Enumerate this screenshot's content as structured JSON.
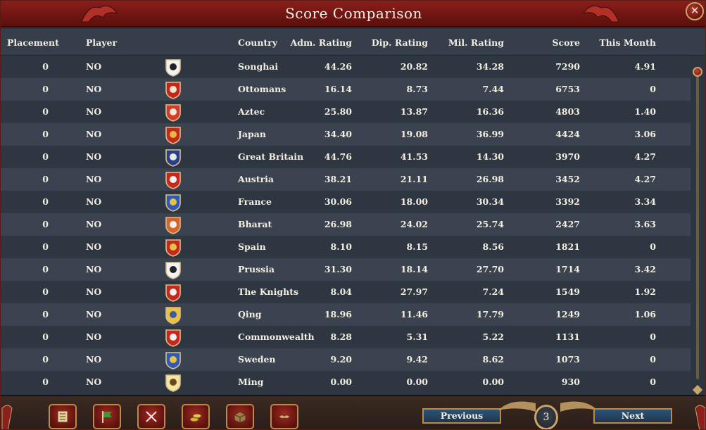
{
  "window": {
    "title": "Score Comparison"
  },
  "headers": {
    "placement": "Placement",
    "player": "Player",
    "country": "Country",
    "adm": "Adm. Rating",
    "dip": "Dip. Rating",
    "mil": "Mil. Rating",
    "score": "Score",
    "month": "This Month"
  },
  "rows": [
    {
      "placement": "0",
      "player": "NO",
      "flag": "songhai-flag-icon",
      "country": "Songhai",
      "adm": "44.26",
      "dip": "20.82",
      "mil": "34.28",
      "score": "7290",
      "month": "4.91"
    },
    {
      "placement": "0",
      "player": "NO",
      "flag": "ottomans-flag-icon",
      "country": "Ottomans",
      "adm": "16.14",
      "dip": "8.73",
      "mil": "7.44",
      "score": "6753",
      "month": "0"
    },
    {
      "placement": "0",
      "player": "NO",
      "flag": "aztec-flag-icon",
      "country": "Aztec",
      "adm": "25.80",
      "dip": "13.87",
      "mil": "16.36",
      "score": "4803",
      "month": "1.40"
    },
    {
      "placement": "0",
      "player": "NO",
      "flag": "japan-flag-icon",
      "country": "Japan",
      "adm": "34.40",
      "dip": "19.08",
      "mil": "36.99",
      "score": "4424",
      "month": "3.06"
    },
    {
      "placement": "0",
      "player": "NO",
      "flag": "great-britain-flag-icon",
      "country": "Great Britain",
      "adm": "44.76",
      "dip": "41.53",
      "mil": "14.30",
      "score": "3970",
      "month": "4.27"
    },
    {
      "placement": "0",
      "player": "NO",
      "flag": "austria-flag-icon",
      "country": "Austria",
      "adm": "38.21",
      "dip": "21.11",
      "mil": "26.98",
      "score": "3452",
      "month": "4.27"
    },
    {
      "placement": "0",
      "player": "NO",
      "flag": "france-flag-icon",
      "country": "France",
      "adm": "30.06",
      "dip": "18.00",
      "mil": "30.34",
      "score": "3392",
      "month": "3.34"
    },
    {
      "placement": "0",
      "player": "NO",
      "flag": "bharat-flag-icon",
      "country": "Bharat",
      "adm": "26.98",
      "dip": "24.02",
      "mil": "25.74",
      "score": "2427",
      "month": "3.63"
    },
    {
      "placement": "0",
      "player": "NO",
      "flag": "spain-flag-icon",
      "country": "Spain",
      "adm": "8.10",
      "dip": "8.15",
      "mil": "8.56",
      "score": "1821",
      "month": "0"
    },
    {
      "placement": "0",
      "player": "NO",
      "flag": "prussia-flag-icon",
      "country": "Prussia",
      "adm": "31.30",
      "dip": "18.14",
      "mil": "27.70",
      "score": "1714",
      "month": "3.42"
    },
    {
      "placement": "0",
      "player": "NO",
      "flag": "the-knights-flag-icon",
      "country": "The Knights",
      "adm": "8.04",
      "dip": "27.97",
      "mil": "7.24",
      "score": "1549",
      "month": "1.92"
    },
    {
      "placement": "0",
      "player": "NO",
      "flag": "qing-flag-icon",
      "country": "Qing",
      "adm": "18.96",
      "dip": "11.46",
      "mil": "17.79",
      "score": "1249",
      "month": "1.06"
    },
    {
      "placement": "0",
      "player": "NO",
      "flag": "commonwealth-flag-icon",
      "country": "Commonwealth",
      "adm": "8.28",
      "dip": "5.31",
      "mil": "5.22",
      "score": "1131",
      "month": "0"
    },
    {
      "placement": "0",
      "player": "NO",
      "flag": "sweden-flag-icon",
      "country": "Sweden",
      "adm": "9.20",
      "dip": "9.42",
      "mil": "8.62",
      "score": "1073",
      "month": "0"
    },
    {
      "placement": "0",
      "player": "NO",
      "flag": "ming-flag-icon",
      "country": "Ming",
      "adm": "0.00",
      "dip": "0.00",
      "mil": "0.00",
      "score": "930",
      "month": "0"
    }
  ],
  "flag_colors": {
    "songhai-flag-icon": [
      "#f2f2f2",
      "#222222"
    ],
    "ottomans-flag-icon": [
      "#c4261c",
      "#f2e6c8"
    ],
    "aztec-flag-icon": [
      "#d23a2a",
      "#f4e8d8"
    ],
    "japan-flag-icon": [
      "#c42a1c",
      "#e8b840"
    ],
    "great-britain-flag-icon": [
      "#2a3f8c",
      "#e8e8e8"
    ],
    "austria-flag-icon": [
      "#c8281c",
      "#f2f2f2"
    ],
    "france-flag-icon": [
      "#2f5cb2",
      "#e8c240"
    ],
    "bharat-flag-icon": [
      "#d8642a",
      "#f2f2f2"
    ],
    "spain-flag-icon": [
      "#c42a1c",
      "#e8c240"
    ],
    "prussia-flag-icon": [
      "#f2f2f2",
      "#222222"
    ],
    "the-knights-flag-icon": [
      "#c42a1c",
      "#f2f2f2"
    ],
    "qing-flag-icon": [
      "#e8c240",
      "#3a5ca8"
    ],
    "commonwealth-flag-icon": [
      "#c8281c",
      "#f2f2f2"
    ],
    "sweden-flag-icon": [
      "#2f5cb2",
      "#e8c240"
    ],
    "ming-flag-icon": [
      "#f2e6a0",
      "#6a4a20"
    ]
  },
  "toolbar": [
    {
      "icon": "ledger-icon"
    },
    {
      "icon": "flag-icon"
    },
    {
      "icon": "crossed-swords-icon"
    },
    {
      "icon": "coins-icon"
    },
    {
      "icon": "crate-icon"
    },
    {
      "icon": "handshake-icon"
    }
  ],
  "pagination": {
    "previous_label": "Previous",
    "next_label": "Next",
    "current_page": "3"
  },
  "theme": {
    "title_bar": "#8a1f1b",
    "row_even": "#2e3641",
    "row_odd": "#3a434f",
    "accent_gold": "#c9a56a",
    "nav_button": "#2f5474"
  },
  "icons": {
    "close": "close-icon"
  }
}
